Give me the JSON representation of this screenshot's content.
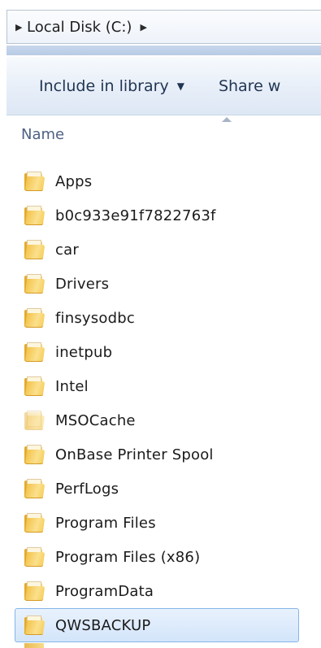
{
  "address_bar": {
    "crumbs": [
      {
        "label": "Local Disk (C:)"
      }
    ]
  },
  "toolbar": {
    "include_label": "Include in library",
    "share_label": "Share w"
  },
  "columns": {
    "name_header": "Name"
  },
  "files": [
    {
      "name": "Apps",
      "icon": "folder-icon"
    },
    {
      "name": "b0c933e91f7822763f",
      "icon": "folder-icon"
    },
    {
      "name": "car",
      "icon": "folder-icon"
    },
    {
      "name": "Drivers",
      "icon": "folder-icon"
    },
    {
      "name": "finsysodbc",
      "icon": "folder-icon"
    },
    {
      "name": "inetpub",
      "icon": "folder-icon"
    },
    {
      "name": "Intel",
      "icon": "folder-icon"
    },
    {
      "name": "MSOCache",
      "icon": "folder-icon",
      "hidden": true
    },
    {
      "name": "OnBase Printer Spool",
      "icon": "folder-icon"
    },
    {
      "name": "PerfLogs",
      "icon": "folder-icon"
    },
    {
      "name": "Program Files",
      "icon": "folder-icon"
    },
    {
      "name": "Program Files (x86)",
      "icon": "folder-icon"
    },
    {
      "name": "ProgramData",
      "icon": "folder-icon"
    },
    {
      "name": "QWSBACKUP",
      "icon": "folder-icon",
      "selected": true
    }
  ],
  "colors": {
    "selection_border": "#85b5e8",
    "selection_fill": "#d3e5fa",
    "header_text": "#4d6185",
    "toolbar_text": "#1f3552"
  }
}
